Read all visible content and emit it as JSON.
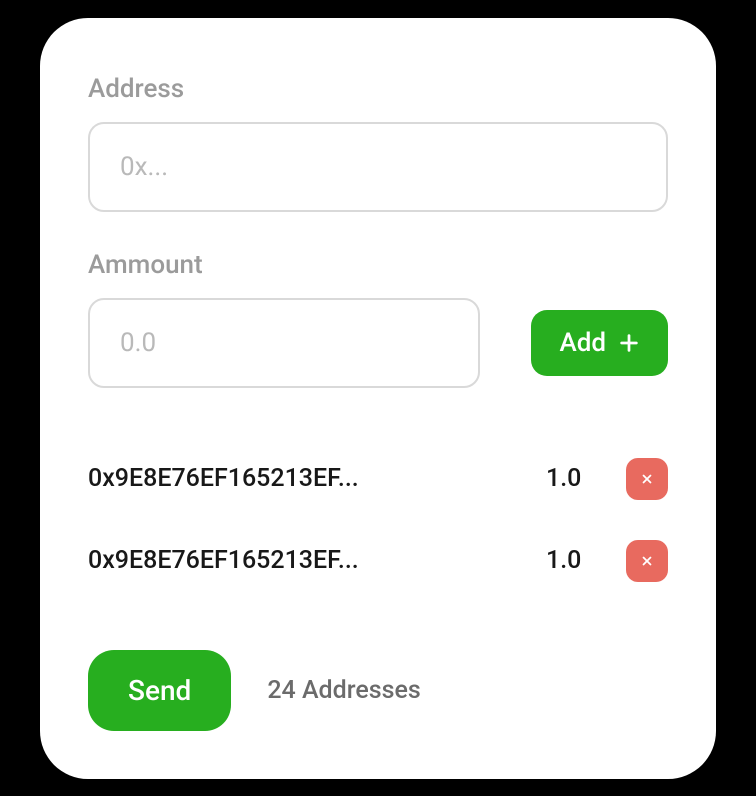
{
  "form": {
    "address_label": "Address",
    "address_placeholder": "0x...",
    "address_value": "",
    "amount_label": "Ammount",
    "amount_placeholder": "0.0",
    "amount_value": "",
    "add_button": "Add"
  },
  "entries": [
    {
      "address": "0x9E8E76EF165213EF...",
      "amount": "1.0"
    },
    {
      "address": "0x9E8E76EF165213EF...",
      "amount": "1.0"
    }
  ],
  "footer": {
    "send_button": "Send",
    "count_text": "24 Addresses"
  },
  "colors": {
    "primary": "#27ae1f",
    "danger": "#e86a5f"
  }
}
